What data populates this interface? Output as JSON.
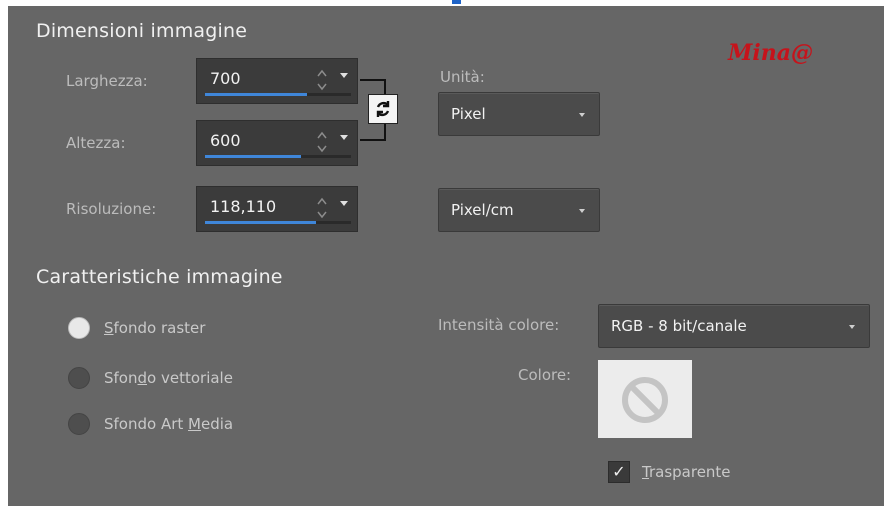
{
  "dimensions": {
    "title": "Dimensioni immagine",
    "width": {
      "label": "Larghezza:",
      "value": "700",
      "fill": 0.7
    },
    "height": {
      "label": "Altezza:",
      "value": "600",
      "fill": 0.66
    },
    "resolution": {
      "label": "Risoluzione:",
      "value": "118,110",
      "fill": 0.76
    },
    "units": {
      "label": "Unità:",
      "size_unit": "Pixel",
      "resolution_unit": "Pixel/cm"
    },
    "link_icon": "aspect-lock-icon"
  },
  "brand": {
    "text": "Mina@"
  },
  "characteristics": {
    "title": "Caratteristiche immagine",
    "background_options": [
      {
        "mnemonic": "S",
        "label_rest": "fondo raster",
        "selected": true
      },
      {
        "label_pre": "Sfon",
        "mnemonic": "d",
        "label_rest": "o vettoriale",
        "selected": false
      },
      {
        "label_pre": "Sfondo Art ",
        "mnemonic": "M",
        "label_rest": "edia",
        "selected": false
      }
    ],
    "color_depth": {
      "label": "Intensità colore:",
      "value": "RGB - 8 bit/canale"
    },
    "color": {
      "label": "Colore:",
      "icon": "no-color-icon"
    },
    "transparent": {
      "mnemonic": "T",
      "label_rest": "rasparente",
      "checked": true
    }
  },
  "colors": {
    "panel": "#666666",
    "accent": "#3f86d9",
    "brand": "#c6131b"
  }
}
